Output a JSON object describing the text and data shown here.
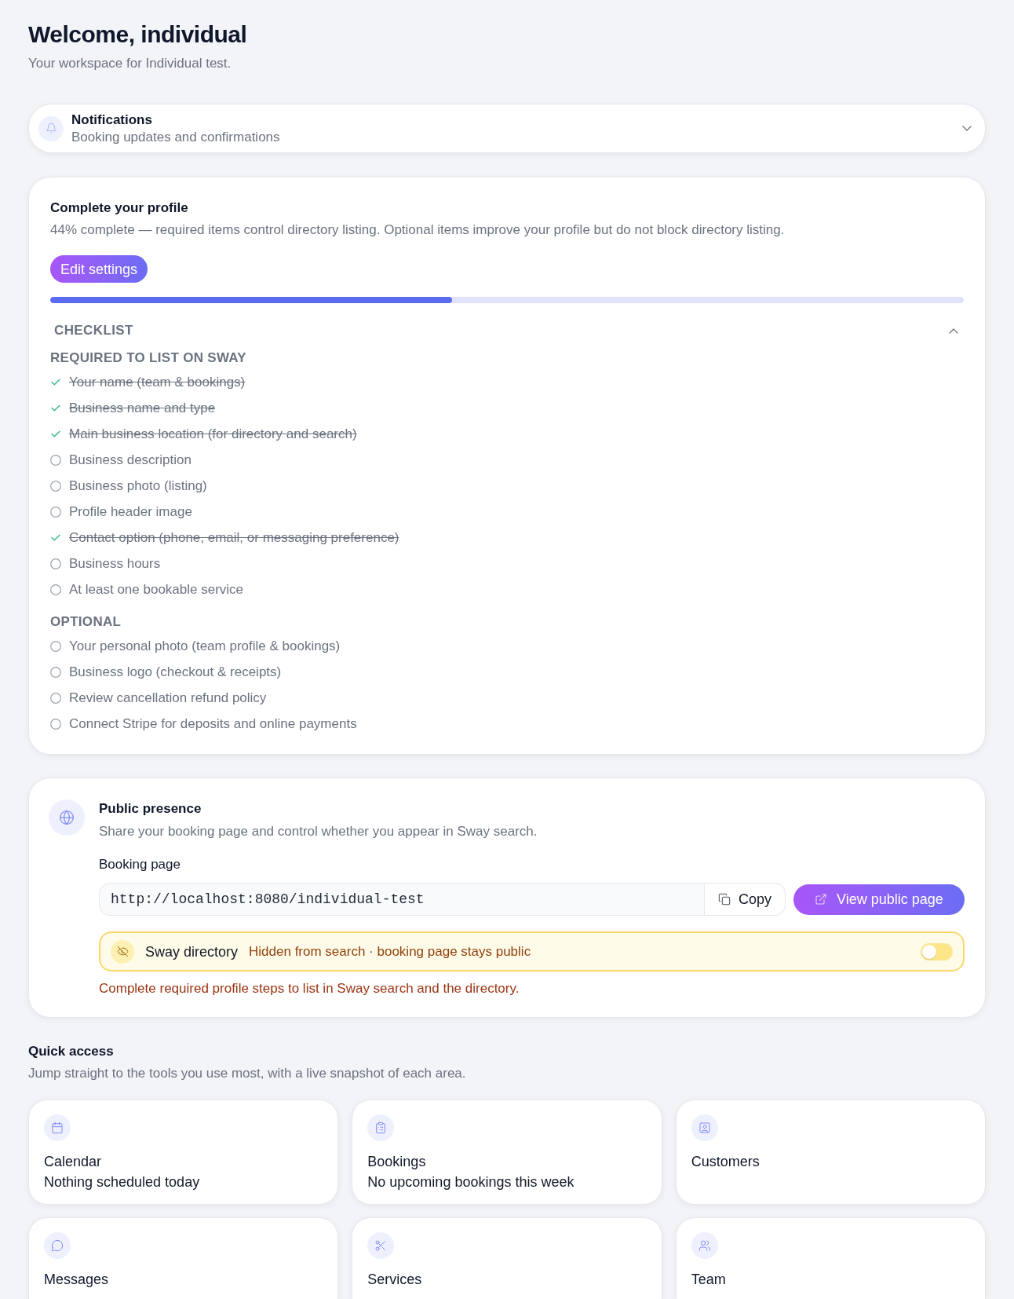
{
  "header": {
    "title": "Welcome, individual",
    "subtitle": "Your workspace for Individual test."
  },
  "notifications": {
    "title": "Notifications",
    "subtitle": "Booking updates and confirmations",
    "expanded": false
  },
  "profile": {
    "title": "Complete your profile",
    "description": "44% complete — required items control directory listing. Optional items improve your profile but do not block directory listing.",
    "button": "Edit settings",
    "progress": {
      "level": 0.44
    },
    "checklist": {
      "title": "CHECKLIST",
      "expanded": true,
      "groups": [
        {
          "title": "REQUIRED TO LIST ON SWAY",
          "items": [
            {
              "label": "Your name (team & bookings)",
              "done": true
            },
            {
              "label": "Business name and type",
              "done": true
            },
            {
              "label": "Main business location (for directory and search)",
              "done": true
            },
            {
              "label": "Business description",
              "done": false
            },
            {
              "label": "Business photo (listing)",
              "done": false
            },
            {
              "label": "Profile header image",
              "done": false
            },
            {
              "label": "Contact option (phone, email, or messaging preference)",
              "done": true
            },
            {
              "label": "Business hours",
              "done": false
            },
            {
              "label": "At least one bookable service",
              "done": false
            }
          ]
        },
        {
          "title": "OPTIONAL",
          "items": [
            {
              "label": "Your personal photo (team profile & bookings)",
              "done": false
            },
            {
              "label": "Business logo (checkout & receipts)",
              "done": false
            },
            {
              "label": "Review cancellation refund policy",
              "done": false
            },
            {
              "label": "Connect Stripe for deposits and online payments",
              "done": false
            }
          ]
        }
      ]
    }
  },
  "public_presence": {
    "title": "Public presence",
    "description": "Share your booking page and control whether you appear in Sway search.",
    "booking_page": {
      "label": "Booking page",
      "value": "http://localhost:8080/individual-test",
      "copy_button": "Copy"
    },
    "view_button": "View public page",
    "directory": {
      "title": "Sway directory",
      "status": "Hidden from search · booking page stays public",
      "on": false
    },
    "warning": "Complete required profile steps to list in Sway search and the directory."
  },
  "quick_access": {
    "title": "Quick access",
    "description": "Jump straight to the tools you use most, with a live snapshot of each area.",
    "cards": [
      {
        "kind": "calendar",
        "title": "Calendar",
        "description": "Nothing scheduled today"
      },
      {
        "kind": "bookings",
        "title": "Bookings",
        "description": "No upcoming bookings this week"
      },
      {
        "kind": "customers",
        "title": "Customers"
      },
      {
        "kind": "messages",
        "title": "Messages"
      },
      {
        "kind": "services",
        "title": "Services"
      },
      {
        "kind": "team",
        "title": "Team"
      }
    ]
  }
}
